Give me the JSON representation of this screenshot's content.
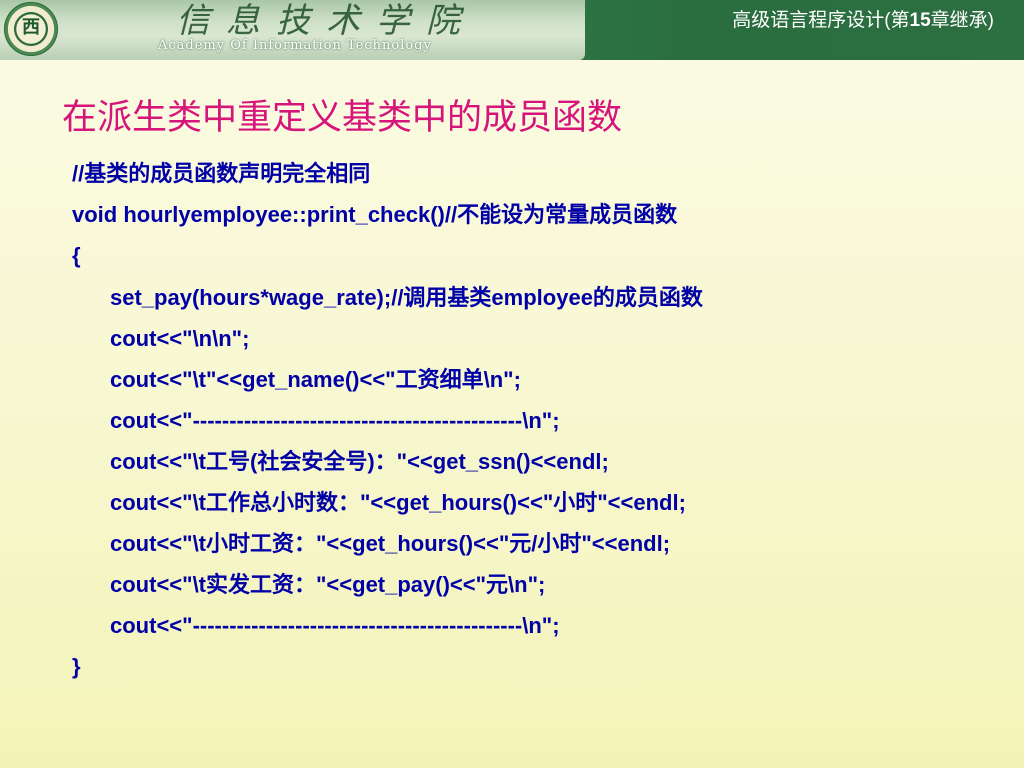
{
  "header": {
    "logo_glyph": "西",
    "school_name_cn": "信息技术学院",
    "school_name_en": "Academy Of Information Technology",
    "course_title_prefix": "高级语言程序设计(第",
    "course_title_num": "15",
    "course_title_suffix": "章继承)"
  },
  "slide": {
    "title": "在派生类中重定义基类中的成员函数"
  },
  "code_lines": [
    "//基类的成员函数声明完全相同",
    "void hourlyemployee::print_check()//不能设为常量成员函数",
    "{",
    "set_pay(hours*wage_rate);//调用基类employee的成员函数",
    "cout<<\"\\n\\n\";",
    "cout<<\"\\t\"<<get_name()<<\"工资细单\\n\";",
    "cout<<\"---------------------------------------------\\n\";",
    "cout<<\"\\t工号(社会安全号)：\"<<get_ssn()<<endl;",
    "cout<<\"\\t工作总小时数：\"<<get_hours()<<\"小时\"<<endl;",
    "cout<<\"\\t小时工资：\"<<get_hours()<<\"元/小时\"<<endl;",
    "cout<<\"\\t实发工资：\"<<get_pay()<<\"元\\n\";",
    "cout<<\"---------------------------------------------\\n\";",
    "}"
  ]
}
